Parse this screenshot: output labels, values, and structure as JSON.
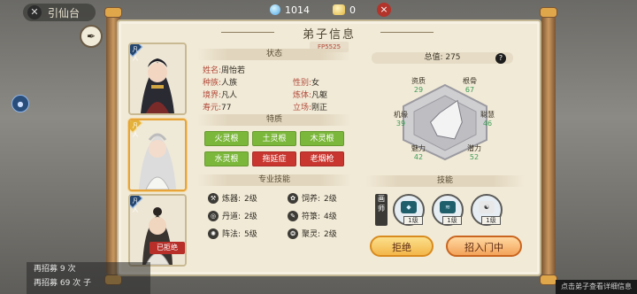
{
  "top": {
    "back_label": "引仙台",
    "gem_count": "1014",
    "coin_count": "0",
    "close_glyph": "×"
  },
  "panel": {
    "title": "弟子信息",
    "subtitle": "FP5525"
  },
  "status": {
    "header": "状态",
    "name_key": "姓名:",
    "name_val": "周怡若",
    "race_key": "种族:",
    "race_val": "人族",
    "gender_key": "性别:",
    "gender_val": "女",
    "realm_key": "境界:",
    "realm_val": "凡人",
    "body_key": "炼体:",
    "body_val": "凡躯",
    "life_key": "寿元:",
    "life_val": "77",
    "stance_key": "立场:",
    "stance_val": "刚正"
  },
  "traits": {
    "header": "特质",
    "items": [
      {
        "label": "火灵根",
        "kind": "good"
      },
      {
        "label": "土灵根",
        "kind": "good"
      },
      {
        "label": "木灵根",
        "kind": "good"
      },
      {
        "label": "水灵根",
        "kind": "good"
      },
      {
        "label": "拖延症",
        "kind": "bad"
      },
      {
        "label": "老烟枪",
        "kind": "bad"
      }
    ],
    "good_color": "#7bb73a",
    "bad_color": "#c8362f"
  },
  "skills_pro": {
    "header": "专业技能",
    "items": [
      {
        "label": "炼器:",
        "level": "2级",
        "icon": "forge-icon"
      },
      {
        "label": "饲养:",
        "level": "2级",
        "icon": "beast-icon"
      },
      {
        "label": "丹道:",
        "level": "2级",
        "icon": "alchemy-icon"
      },
      {
        "label": "符箓:",
        "level": "4级",
        "icon": "talisman-icon"
      },
      {
        "label": "阵法:",
        "level": "5级",
        "icon": "formation-icon"
      },
      {
        "label": "聚灵:",
        "level": "2级",
        "icon": "spirit-icon"
      }
    ]
  },
  "attributes": {
    "total_label": "总值:",
    "total_value": "275",
    "items": [
      {
        "name": "资质",
        "value": "29"
      },
      {
        "name": "根骨",
        "value": "67"
      },
      {
        "name": "机缘",
        "value": "39"
      },
      {
        "name": "聪慧",
        "value": "46"
      },
      {
        "name": "魅力",
        "value": "42"
      },
      {
        "name": "潜力",
        "value": "52"
      }
    ]
  },
  "combat_skills": {
    "header": "技能",
    "badge": "画师",
    "items": [
      {
        "level": "1级",
        "icon": "skill-1-icon"
      },
      {
        "level": "1级",
        "icon": "skill-2-icon"
      },
      {
        "level": "1级",
        "icon": "skill-3-icon"
      }
    ]
  },
  "candidates": [
    {
      "badge": "凡人",
      "selected": false,
      "rejected": false
    },
    {
      "badge": "凡人",
      "selected": true,
      "rejected": false
    },
    {
      "badge": "凡人",
      "selected": false,
      "rejected": true,
      "rejected_label": "已拒绝"
    }
  ],
  "actions": {
    "reject_label": "拒绝",
    "recruit_label": "招入门中"
  },
  "log": {
    "line1": "再招募 9 次",
    "line2": "再招募 69 次 子"
  },
  "hint": "点击弟子查看详细信息"
}
